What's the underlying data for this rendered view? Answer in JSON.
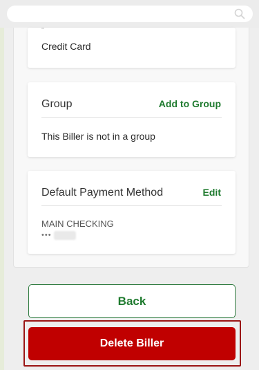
{
  "search": {
    "icon": "search-icon"
  },
  "payment_type_card": {
    "value": "Credit Card"
  },
  "group_card": {
    "title": "Group",
    "action_label": "Add to Group",
    "status_text": "This Biller is not in a group"
  },
  "default_payment_card": {
    "title": "Default Payment Method",
    "action_label": "Edit",
    "account_name": "MAIN CHECKING",
    "account_mask": "•••"
  },
  "buttons": {
    "back_label": "Back",
    "delete_label": "Delete Biller"
  },
  "colors": {
    "accent_green": "#1e7a2e",
    "danger_red": "#c00000",
    "focus_outline": "#9a1414"
  }
}
